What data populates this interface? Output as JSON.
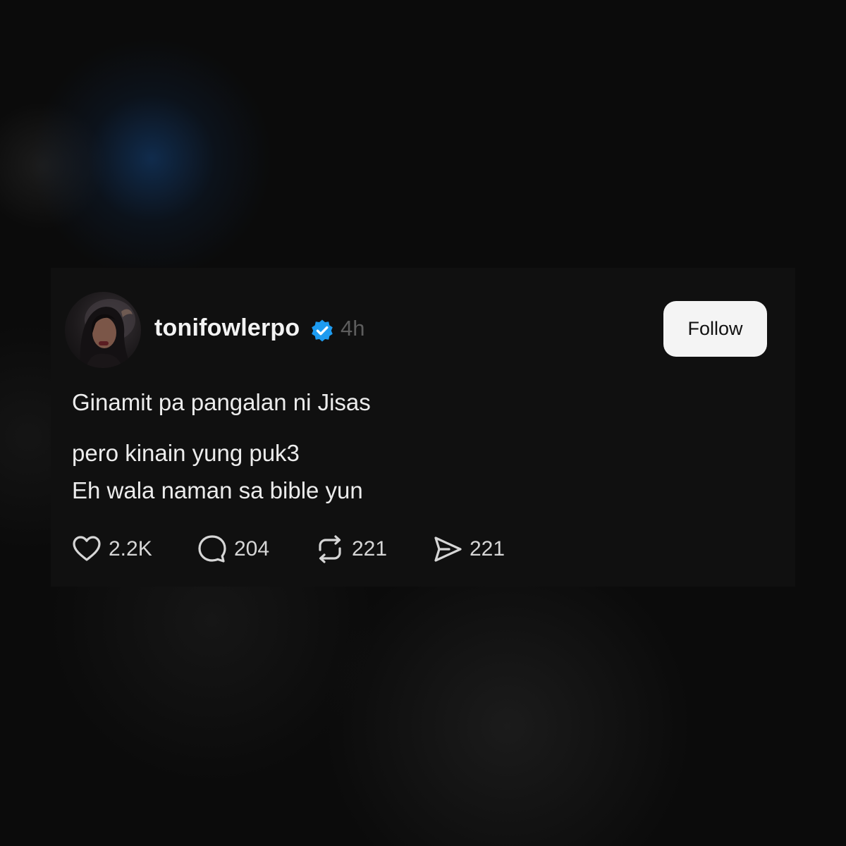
{
  "post": {
    "username": "tonifowlerpo",
    "timestamp": "4h",
    "verified": true,
    "follow_label": "Follow",
    "lines": [
      "Ginamit pa pangalan ni Jisas",
      "pero kinain yung puk3",
      "Eh wala naman sa bible yun"
    ],
    "stats": {
      "likes": "2.2K",
      "comments": "204",
      "reposts": "221",
      "shares": "221"
    }
  },
  "icons": {
    "verified": "verified-badge-icon",
    "like": "heart-icon",
    "comment": "comment-bubble-icon",
    "repost": "repost-icon",
    "share": "send-icon"
  },
  "colors": {
    "background": "#0b0b0b",
    "card": "#101010",
    "text": "#ececec",
    "muted": "#5d5d5d",
    "verified": "#1d9bf0",
    "button_bg": "#f4f4f4"
  }
}
